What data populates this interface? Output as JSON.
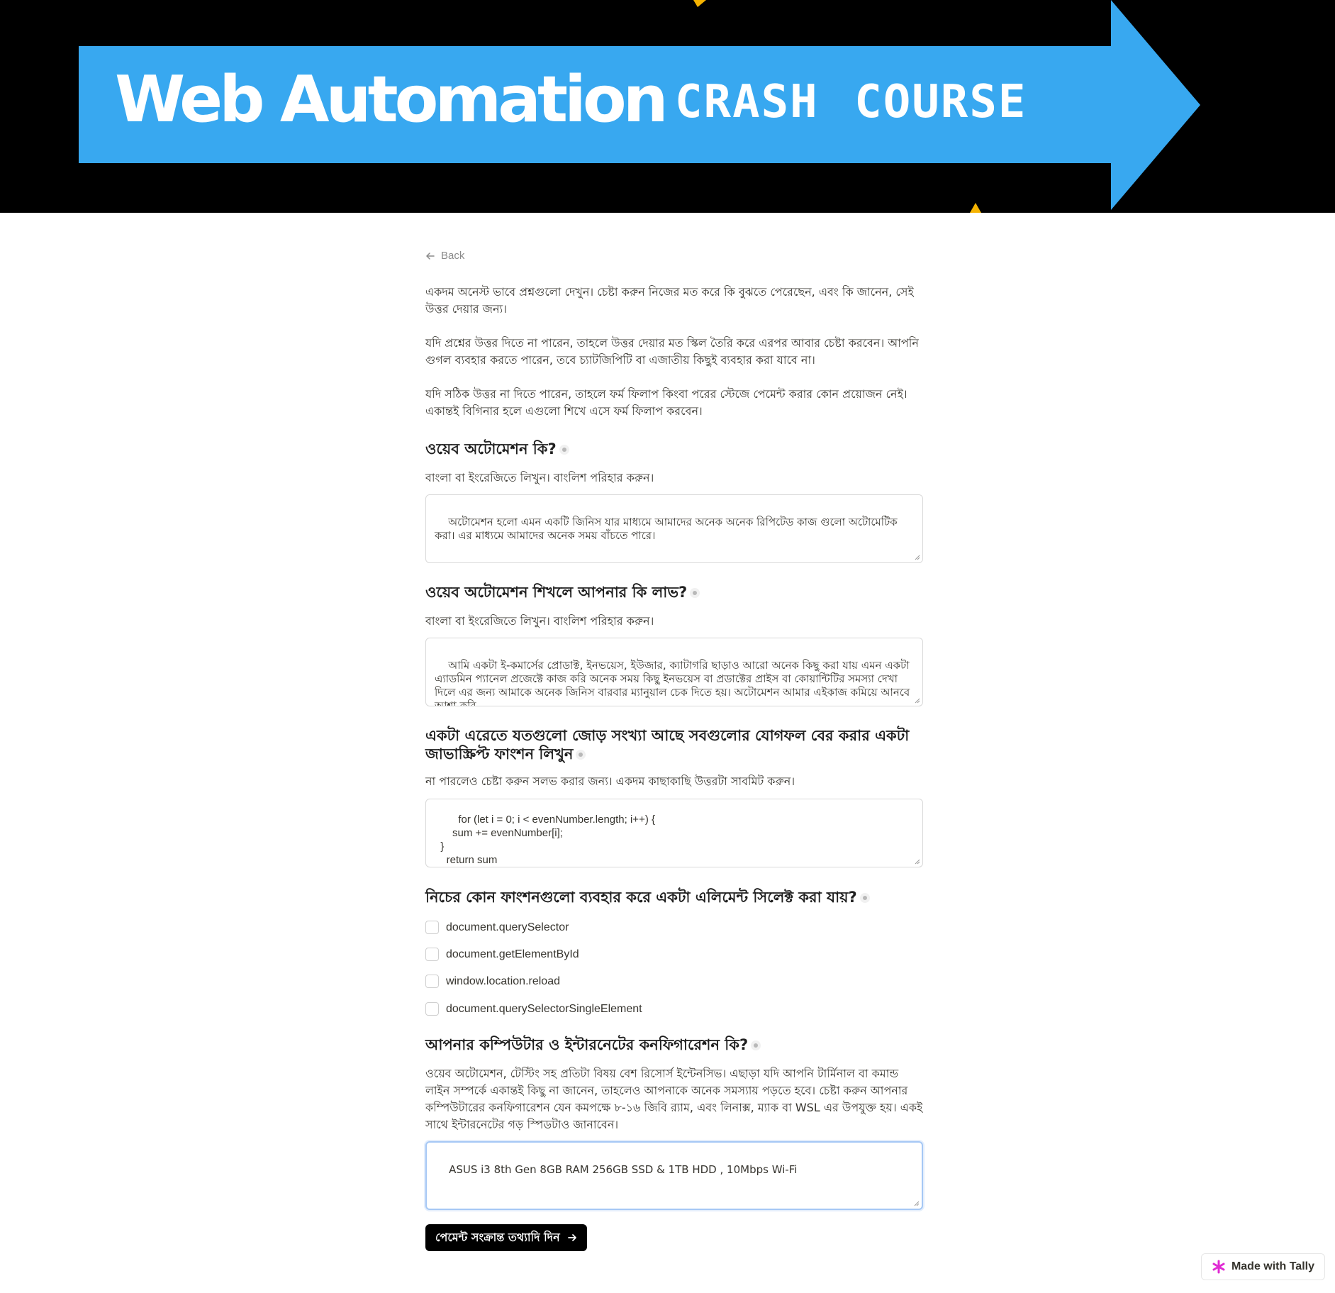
{
  "banner": {
    "title": "Web Automation",
    "subtitle": "CRASH COURSE",
    "colors": {
      "background": "#000000",
      "arrow": "#38a8f0",
      "accent": "#f5b301"
    }
  },
  "nav": {
    "back_label": "Back",
    "back_icon": "arrow-left-icon"
  },
  "intro": {
    "p1": "একদম অনেস্ট ভাবে প্রশ্নগুলো দেখুন। চেষ্টা করুন নিজের মত করে কি বুঝতে পেরেছেন, এবং কি জানেন, সেই উত্তর দেয়ার জন্য।",
    "p2": "যদি প্রশ্নের উত্তর দিতে না পারেন, তাহলে উত্তর দেয়ার মত স্কিল তৈরি করে এরপর আবার চেষ্টা করবেন। আপনি গুগল ব্যবহার করতে পারেন, তবে চ্যাটজিপিটি বা এজাতীয় কিছুই ব্যবহার করা যাবে না।",
    "p3": " যদি সঠিক উত্তর না দিতে পারেন, তাহলে ফর্ম ফিলাপ কিংবা পরের স্টেজে পেমেন্ট করার কোন প্রয়োজন নেই। একান্তই বিগিনার হলে এগুলো শিখে এসে ফর্ম ফিলাপ করবেন।"
  },
  "questions": [
    {
      "title": "ওয়েব অটোমেশন কি?",
      "hint": "বাংলা বা ইংরেজিতে লিখুন। বাংলিশ পরিহার করুন।",
      "answer": "অটোমেশন হলো এমন একটি জিনিস যার মাধ্যমে আমাদের অনেক অনেক রিপিটেড কাজ গুলো অটোমেটিক করা। এর মাধ্যমে আমাদের অনেক সময় বাঁচতে পারে।"
    },
    {
      "title": "ওয়েব অটোমেশন শিখলে আপনার কি লাভ?",
      "hint": "বাংলা বা ইংরেজিতে লিখুন। বাংলিশ পরিহার করুন।",
      "answer": "আমি একটা ই-কমার্সের প্রোডাক্ট, ইনভয়েস, ইউজার, ক্যাটাগরি ছাড়াও আরো অনেক কিছু করা যায় এমন একটা এ্যাডমিন প্যানেল প্রজেক্টে কাজ করি অনেক সময় কিছু ইনভয়েস বা প্রডাক্টের প্রাইস বা কোয়ান্টিটির সমস্যা দেখা দিলে এর জন্য আমাকে অনেক জিনিস বারবার ম্যানুয়াল চেক দিতে হয়। অটোমেশন আমার এইকাজ কমিয়ে আনবে আশা করি"
    },
    {
      "title": "একটা এরেতে যতগুলো জোড় সংখ্যা আছে সবগুলোর যোগফল বের করার একটা জাভাস্ক্রিপ্ট ফাংশন লিখুন",
      "hint": "না পারলেও চেষ্টা করুন সলভ করার জন্য। একদম কাছাকাছি উত্তরটা সাবমিট করুন।",
      "answer": "    for (let i = 0; i < evenNumber.length; i++) {\n      sum += evenNumber[i];\n  }\n    return sum\n  }"
    },
    {
      "title": "নিচের কোন ফাংশনগুলো ব্যবহার করে একটা এলিমেন্ট সিলেক্ট করা যায়?",
      "options": [
        "document.querySelector",
        "document.getElementById",
        "window.location.reload",
        "document.querySelectorSingleElement"
      ]
    },
    {
      "title": "আপনার কম্পিউটার ও ইন্টারনেটের কনফিগারেশন কি?",
      "hint": "ওয়েব অটোমেশন, টেস্টিং সহ প্রতিটা বিষয় বেশ রিসোর্স ইন্টেনসিভ। এছাড়া যদি আপনি টার্মিনাল বা কমান্ড লাইন সম্পর্কে একান্তই কিছু না জানেন, তাহলেও আপনাকে অনেক সমস্যায় পড়তে হবে। চেষ্টা করুন আপনার কম্পিউটারের কনফিগারেশন যেন কমপক্ষে ৮-১৬ জিবি র‍্যাম, এবং লিনাক্স, ম্যাক বা WSL এর উপযুক্ত হয়। একই সাথে ইন্টারনেটের গড় স্পিডটাও জানাবেন।",
      "answer": "ASUS i3 8th Gen 8GB RAM 256GB SSD & 1TB HDD , 10Mbps Wi-Fi"
    }
  ],
  "submit": {
    "label": "পেমেন্ট সংক্রান্ত তথ্যাদি দিন",
    "icon": "arrow-right-icon"
  },
  "badge": {
    "label": "Made with Tally",
    "icon": "tally-logo-icon",
    "icon_color": "#e02ad3"
  }
}
